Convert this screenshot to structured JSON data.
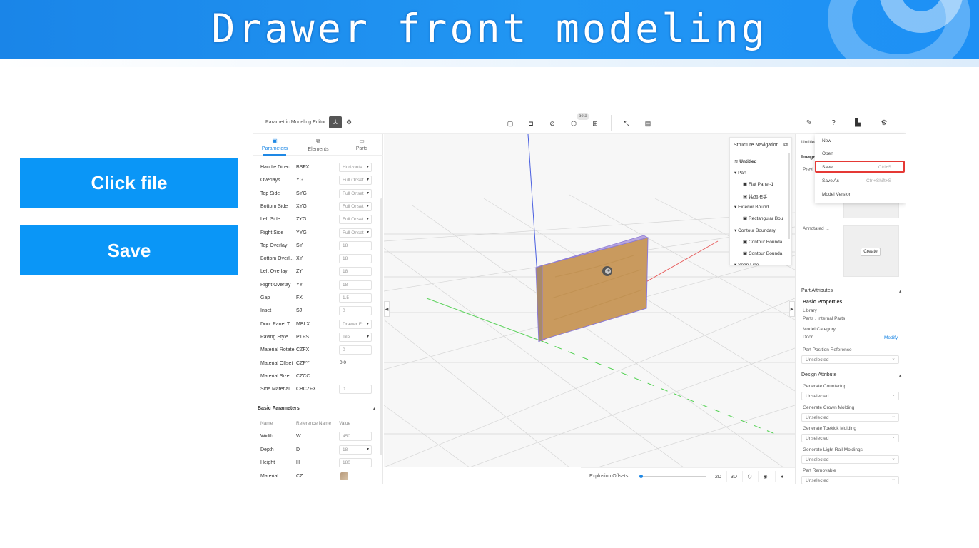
{
  "slide": {
    "title": "Drawer front modeling",
    "steps": [
      "Click file",
      "Save"
    ]
  },
  "app": {
    "editor_title": "Parametric Modeling Editor",
    "beta_badge": "beta",
    "left_panel": {
      "tabs": [
        {
          "label": "Parameters",
          "icon": "document-icon",
          "active": true
        },
        {
          "label": "Elements",
          "icon": "layers-icon",
          "active": false
        },
        {
          "label": "Parts",
          "icon": "folder-icon",
          "active": false
        }
      ],
      "params": [
        {
          "name": "Handle Direct...",
          "ref": "BSFX",
          "value": "Horizonta",
          "dropdown": true
        },
        {
          "name": "Overlays",
          "ref": "YG",
          "value": "Full Onset",
          "dropdown": true
        },
        {
          "name": "Top Side",
          "ref": "SYG",
          "value": "Full Onset",
          "dropdown": true
        },
        {
          "name": "Bottom Side",
          "ref": "XYG",
          "value": "Full Onset",
          "dropdown": true
        },
        {
          "name": "Left Side",
          "ref": "ZYG",
          "value": "Full Onset",
          "dropdown": true
        },
        {
          "name": "Right Side",
          "ref": "YYG",
          "value": "Full Onset",
          "dropdown": true
        },
        {
          "name": "Top Overlay",
          "ref": "SY",
          "value": "18",
          "dropdown": false
        },
        {
          "name": "Bottom Overl...",
          "ref": "XY",
          "value": "18",
          "dropdown": false
        },
        {
          "name": "Left Overlay",
          "ref": "ZY",
          "value": "18",
          "dropdown": false
        },
        {
          "name": "Right Overlay",
          "ref": "YY",
          "value": "18",
          "dropdown": false
        },
        {
          "name": "Gap",
          "ref": "FX",
          "value": "1.5",
          "dropdown": false
        },
        {
          "name": "Inset",
          "ref": "SJ",
          "value": "0",
          "dropdown": false
        },
        {
          "name": "Door Panel T...",
          "ref": "MBLX",
          "value": "Drawer Fr",
          "dropdown": true
        },
        {
          "name": "Paving Style",
          "ref": "PTFS",
          "value": "Tile",
          "dropdown": true
        },
        {
          "name": "Material Rotate",
          "ref": "CZFX",
          "value": "0",
          "dropdown": false
        },
        {
          "name": "Material Offset",
          "ref": "CZPY",
          "value": "0,0",
          "plain": true
        },
        {
          "name": "Material Size",
          "ref": "CZCC",
          "value": "",
          "plain": true
        },
        {
          "name": "Side Material ...",
          "ref": "CBCZFX",
          "value": "0",
          "dropdown": false
        }
      ],
      "basic_section": {
        "title": "Basic Parameters",
        "col_name": "Name",
        "col_ref": "Reference Name",
        "col_value": "Value",
        "rows": [
          {
            "name": "Width",
            "ref": "W",
            "value": "450",
            "dropdown": false
          },
          {
            "name": "Depth",
            "ref": "D",
            "value": "18",
            "dropdown": true
          },
          {
            "name": "Height",
            "ref": "H",
            "value": "180",
            "dropdown": false
          },
          {
            "name": "Material",
            "ref": "CZ",
            "value": "",
            "swatch": true
          }
        ]
      }
    },
    "structure_nav": {
      "title": "Structure Navigation",
      "root": "Untitled",
      "items": [
        {
          "label": "Part",
          "level": 0
        },
        {
          "label": "Flat Panel-1",
          "level": 1
        },
        {
          "label": "抽面把手",
          "level": 1
        },
        {
          "label": "Exterior Bound",
          "level": 0
        },
        {
          "label": "Rectangular Bou",
          "level": 1
        },
        {
          "label": "Contour Boundary",
          "level": 0
        },
        {
          "label": "Contour Bounda",
          "level": 1
        },
        {
          "label": "Contour Bounda",
          "level": 1
        },
        {
          "label": "Span Line",
          "level": 0
        }
      ]
    },
    "bottom_bar": {
      "explosion_label": "Explosion Offsets",
      "explosion_value": 0,
      "btn_2d": "2D",
      "btn_3d": "3D"
    },
    "right_panel": {
      "doc_name": "Untitled",
      "image_section": "Image",
      "preview_label": "Previ",
      "annotated_label": "Annotated ...",
      "create_label": "Create",
      "part_attributes": "Part Attributes",
      "basic_properties": "Basic Properties",
      "library_label": "Library",
      "library_value": "Parts , Internal Parts",
      "model_category_label": "Model Category",
      "model_category_value": "Door",
      "modify_link": "Modify",
      "part_position_label": "Part Position Reference",
      "unselected": "Unselected",
      "design_attribute": "Design Attribute",
      "design_fields": [
        "Generate Countertop",
        "Generate Crown Molding",
        "Generate Toekick Molding",
        "Generate Light Rail Moldings",
        "Part Removable"
      ]
    },
    "file_menu": {
      "items": [
        {
          "label": "New",
          "shortcut": ""
        },
        {
          "label": "Open",
          "shortcut": ""
        },
        {
          "label": "Save",
          "shortcut": "Ctrl+S"
        },
        {
          "label": "Save As",
          "shortcut": "Ctrl+Shift+S"
        },
        {
          "label": "Model Version",
          "shortcut": ""
        }
      ],
      "highlighted": "Save"
    }
  },
  "colors": {
    "banner": "#1e90f5",
    "step_box": "#0a96f7",
    "accent": "#1e88e5",
    "highlight": "#e53935",
    "panel_wood": "#c99a5e"
  }
}
